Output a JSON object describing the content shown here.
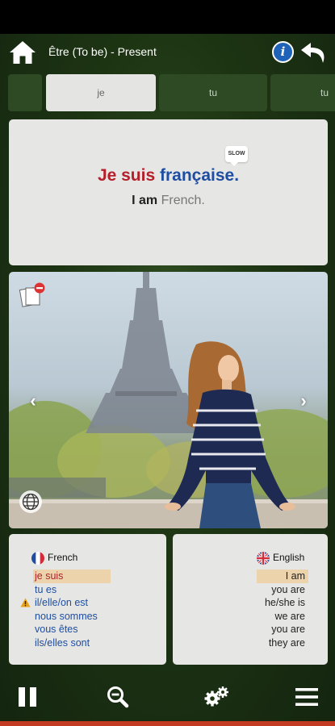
{
  "topbar": {
    "title": "Être (To be) - Present"
  },
  "tabs": [
    {
      "label": ""
    },
    {
      "label": "je"
    },
    {
      "label": "tu"
    },
    {
      "label": "tu"
    }
  ],
  "sentence": {
    "slow_badge": "SLOW",
    "french_subject": "Je suis",
    "french_rest": "française.",
    "english_subject": "I am",
    "english_rest": "French."
  },
  "photo": {
    "alt": "woman sitting on a wall in front of the Eiffel Tower"
  },
  "french_panel": {
    "header": "French",
    "rows": [
      {
        "text": "je suis",
        "highlighted": true
      },
      {
        "text": "tu es"
      },
      {
        "text": "il/elle/on est",
        "warning": true
      },
      {
        "text": "nous sommes"
      },
      {
        "text": "vous êtes"
      },
      {
        "text": "ils/elles sont"
      }
    ]
  },
  "english_panel": {
    "header": "English",
    "rows": [
      {
        "text": "I am",
        "highlighted": true
      },
      {
        "text": "you are"
      },
      {
        "text": "he/she is"
      },
      {
        "text": "we are"
      },
      {
        "text": "you are"
      },
      {
        "text": "they are"
      }
    ]
  },
  "icons": {
    "home": "home-icon",
    "info": "info-icon",
    "back": "undo-arrow-icon",
    "pause": "pause-icon",
    "zoom": "zoom-out-icon",
    "settings": "gears-icon",
    "menu": "hamburger-menu-icon"
  },
  "colors": {
    "background": "#1d3413",
    "card": "#e6e6e4",
    "french_red": "#b3202c",
    "french_blue": "#1f4ea1",
    "highlight": "#ecd3ab",
    "info_blue": "#1f63b8"
  }
}
